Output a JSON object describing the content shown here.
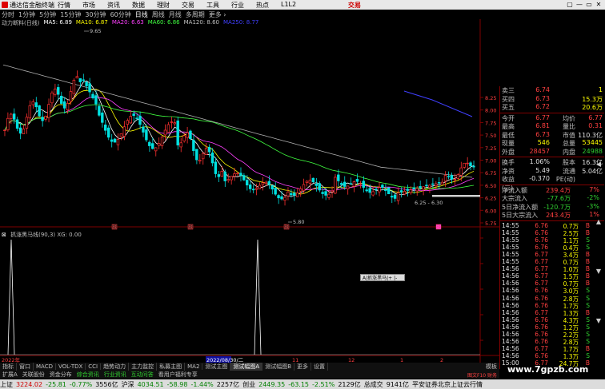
{
  "titlebar": {
    "app_title": "通达信金融终端",
    "menu": [
      "行情",
      "市场",
      "资讯",
      "数据",
      "理财",
      "交易",
      "工具",
      "行业",
      "热点",
      "L1L2"
    ],
    "brand": "交易",
    "buttons": [
      "▢",
      "—",
      "▭",
      "✕"
    ]
  },
  "periods": [
    {
      "label": "分时"
    },
    {
      "label": "1分钟"
    },
    {
      "label": "5分钟"
    },
    {
      "label": "15分钟"
    },
    {
      "label": "30分钟"
    },
    {
      "label": "60分钟"
    },
    {
      "label": "日线",
      "active": true
    },
    {
      "label": "周线"
    },
    {
      "label": "月线"
    },
    {
      "label": "多周期",
      "hl": false
    },
    {
      "label": "更多 ›"
    }
  ],
  "chart_header": {
    "title": "动力断料(日线)",
    "ma": [
      {
        "label": "MA5: 6.89",
        "color": "#ffffff"
      },
      {
        "label": "MA10: 6.87",
        "color": "#ffff00"
      },
      {
        "label": "MA20: 6.63",
        "color": "#ff40ff"
      },
      {
        "label": "MA60: 6.86",
        "color": "#40ff40"
      },
      {
        "label": "MA120: 8.60",
        "color": "#c0c0c0"
      },
      {
        "label": "MA250: 8.77",
        "color": "#4040ff"
      }
    ]
  },
  "chart_data": {
    "type": "candlestick",
    "price_axis_ticks": [
      8.25,
      8.0,
      7.75,
      7.5,
      7.25,
      7.0,
      6.75,
      6.5,
      6.25,
      6.0,
      5.75
    ],
    "annotations": [
      {
        "text": "9.65",
        "kind": "high"
      },
      {
        "text": "5.80",
        "kind": "low"
      },
      {
        "text": "6.25 - 6.30",
        "kind": "range"
      }
    ],
    "event_marks": [
      "融",
      "融",
      "融",
      "融"
    ],
    "indicator": {
      "name": "抓涨黑马线(90,3)",
      "value": "XG: 0.00",
      "spikes": 2
    },
    "x_labels": [
      "2022年",
      "",
      "",
      "2022/08/30/二",
      "11",
      "12",
      "1",
      "2"
    ]
  },
  "indicator_header": {
    "close_glyph": "⊠",
    "text": "抓涨黑马线(90,3) XG: 0.00"
  },
  "floatbar": {
    "label": "A|抓涨黑马|+ |-"
  },
  "quote": {
    "rows": [
      {
        "l": "卖三",
        "v": "6.74",
        "vc": "red",
        "r": "1",
        "rc": "yellow"
      },
      {
        "l": "买四",
        "v": "6.73",
        "vc": "red",
        "r": "15.3万",
        "rc": "yellow"
      },
      {
        "l": "买五",
        "v": "6.72",
        "vc": "red",
        "r": "20.6万",
        "rc": "yellow"
      }
    ],
    "grid": [
      {
        "l": "今开",
        "v": "6.77",
        "vc": "red",
        "l2": "均价",
        "v2": "6.77",
        "v2c": "red"
      },
      {
        "l": "最高",
        "v": "6.81",
        "vc": "red",
        "l2": "量比",
        "v2": "0.31",
        "v2c": "red"
      },
      {
        "l": "最低",
        "v": "6.73",
        "vc": "red",
        "l2": "市值",
        "v2": "110.3亿",
        "v2c": "white"
      },
      {
        "l": "现量",
        "v": "546",
        "vc": "yellow",
        "l2": "总量",
        "v2": "53445",
        "v2c": "yellow"
      },
      {
        "l": "外盘",
        "v": "28457",
        "vc": "red",
        "l2": "内盘",
        "v2": "24988",
        "v2c": "green"
      }
    ],
    "grid2": [
      {
        "l": "换手",
        "v": "1.06%",
        "vc": "white",
        "l2": "股本",
        "v2": "16.3亿",
        "v2c": "white"
      },
      {
        "l": "净资",
        "v": "5.49",
        "vc": "white",
        "l2": "流通",
        "v2": "5.04亿",
        "v2c": "white"
      },
      {
        "l": "收益(三)",
        "v": "-0.370",
        "vc": "white",
        "l2": "PE(动)",
        "v2": "",
        "v2c": "white"
      }
    ],
    "flows": [
      {
        "l": "净流入额",
        "v": "239.4万",
        "vc": "red",
        "r": "7%",
        "rc": "red"
      },
      {
        "l": "大宗流入",
        "v": "-77.6万",
        "vc": "green",
        "r": "-2%",
        "rc": "green"
      },
      {
        "l": "5日净流入额",
        "v": "-120.7万",
        "vc": "green",
        "r": "-3%",
        "rc": "green"
      },
      {
        "l": "5日大宗流入",
        "v": "243.4万",
        "vc": "red",
        "r": "1%",
        "rc": "red"
      }
    ],
    "ticks": [
      {
        "t": "14:55",
        "p": "6.76",
        "q": "0.7万",
        "d": "B",
        "dc": "red"
      },
      {
        "t": "14:55",
        "p": "6.76",
        "q": "2.5万",
        "d": "B",
        "dc": "red"
      },
      {
        "t": "14:55",
        "p": "6.76",
        "q": "1.1万",
        "d": "S",
        "dc": "green"
      },
      {
        "t": "14:55",
        "p": "6.76",
        "q": "0.4万",
        "d": "S",
        "dc": "green"
      },
      {
        "t": "14:55",
        "p": "6.77",
        "q": "3.4万",
        "d": "B",
        "dc": "red"
      },
      {
        "t": "14:55",
        "p": "6.77",
        "q": "0.7万",
        "d": "B",
        "dc": "red"
      },
      {
        "t": "14:56",
        "p": "6.77",
        "q": "1.0万",
        "d": "B",
        "dc": "red"
      },
      {
        "t": "14:56",
        "p": "6.77",
        "q": "1.5万",
        "d": "B",
        "dc": "red"
      },
      {
        "t": "14:56",
        "p": "6.77",
        "q": "0.7万",
        "d": "B",
        "dc": "red"
      },
      {
        "t": "14:56",
        "p": "6.76",
        "q": "3.0万",
        "d": "S",
        "dc": "green"
      },
      {
        "t": "14:56",
        "p": "6.76",
        "q": "2.8万",
        "d": "S",
        "dc": "green"
      },
      {
        "t": "14:56",
        "p": "6.76",
        "q": "1.7万",
        "d": "S",
        "dc": "green"
      },
      {
        "t": "14:56",
        "p": "6.77",
        "q": "1.3万",
        "d": "B",
        "dc": "red"
      },
      {
        "t": "14:56",
        "p": "6.76",
        "q": "4.3万",
        "d": "S",
        "dc": "green"
      },
      {
        "t": "14:56",
        "p": "6.76",
        "q": "1.2万",
        "d": "S",
        "dc": "green"
      },
      {
        "t": "14:56",
        "p": "6.76",
        "q": "2.2万",
        "d": "S",
        "dc": "green"
      },
      {
        "t": "14:56",
        "p": "6.76",
        "q": "2.8万",
        "d": "S",
        "dc": "green"
      },
      {
        "t": "14:56",
        "p": "6.77",
        "q": "1.7万",
        "d": "B",
        "dc": "red"
      },
      {
        "t": "14:56",
        "p": "6.76",
        "q": "1.3万",
        "d": "S",
        "dc": "green"
      },
      {
        "t": "15:00",
        "p": "6.77",
        "q": "24.7万",
        "d": "B",
        "dc": "red"
      }
    ]
  },
  "tabs1": [
    "指标",
    "窗口",
    "MACD",
    "VOL-TDX",
    "CCI",
    "趋势动力",
    "主力监控",
    "私募主图",
    "MA2",
    "测试主图",
    "测试幅图A",
    "测试幅图B",
    "更多",
    "设置"
  ],
  "tabs1_active": 10,
  "tabs2": [
    {
      "label": "扩展A"
    },
    {
      "label": "关联股份"
    },
    {
      "label": "资金分布"
    },
    {
      "label": "综合资讯",
      "g": true
    },
    {
      "label": "行业资讯",
      "g": true
    },
    {
      "label": "互动问答",
      "g": true
    },
    {
      "label": "看用户福利专享"
    }
  ],
  "tabs2_right": "图文F10 财务",
  "right_tab_label": "模板",
  "status": [
    {
      "text": "上证",
      "c": ""
    },
    {
      "text": "3224.02",
      "c": "r"
    },
    {
      "text": "-25.81",
      "c": "g"
    },
    {
      "text": "-0.77%",
      "c": "g"
    },
    {
      "text": "3556亿",
      "c": ""
    },
    {
      "text": "沪深",
      "c": ""
    },
    {
      "text": "4034.51",
      "c": "g"
    },
    {
      "text": "-58.98",
      "c": "g"
    },
    {
      "text": "-1.44%",
      "c": "g"
    },
    {
      "text": "2257亿",
      "c": ""
    },
    {
      "text": "创业",
      "c": ""
    },
    {
      "text": "2449.35",
      "c": "g"
    },
    {
      "text": "-63.15",
      "c": "g"
    },
    {
      "text": "-2.51%",
      "c": "g"
    },
    {
      "text": "2129亿",
      "c": ""
    },
    {
      "text": "总成交",
      "c": ""
    },
    {
      "text": "9141亿",
      "c": ""
    },
    {
      "text": "平安证券北京上证云行情",
      "c": ""
    }
  ],
  "watermark": "www.7gpzb.com"
}
